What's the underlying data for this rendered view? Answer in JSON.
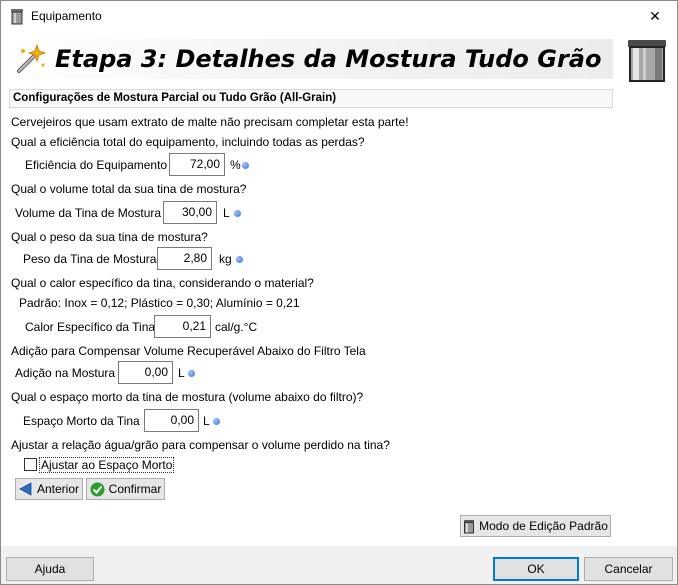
{
  "window": {
    "title": "Equipamento",
    "close_glyph": "✕",
    "icon": "pot-icon"
  },
  "header": {
    "title": "Etapa 3: Detalhes da Mostura Tudo Grão",
    "left_icon": "magic-wand-icon",
    "right_icon": "brew-pot-icon"
  },
  "section": {
    "title": "Configurações de Mostura Parcial ou Tudo Grão (All-Grain)"
  },
  "form": {
    "intro": "Cervejeiros que usam extrato de malte não precisam completar esta parte!",
    "q_efficiency": "Qual a eficiência total do equipamento, incluindo todas as perdas?",
    "efficiency_label": "Eficiência do Equipamento",
    "efficiency_value": "72,00",
    "efficiency_unit": "%",
    "q_volume": "Qual o volume total da sua tina de mostura?",
    "volume_label": "Volume da Tina de Mostura",
    "volume_value": "30,00",
    "volume_unit": "L",
    "q_weight": "Qual o peso da sua tina de mostura?",
    "weight_label": "Peso da Tina de Mostura",
    "weight_value": "2,80",
    "weight_unit": "kg",
    "q_specific_heat": "Qual o calor específico da tina, considerando o material?",
    "specific_heat_defaults": "Padrão:  Inox = 0,12;  Plástico = 0,30;  Alumínio = 0,21",
    "specific_heat_label": "Calor Específico da Tina",
    "specific_heat_value": "0,21",
    "specific_heat_unit": "cal/g.°C",
    "q_addition": "Adição para Compensar Volume Recuperável Abaixo do Filtro Tela",
    "addition_label": "Adição na Mostura",
    "addition_value": "0,00",
    "addition_unit": "L",
    "q_deadspace": "Qual o espaço morto da tina de mostura (volume abaixo do filtro)?",
    "deadspace_label": "Espaço Morto da Tina",
    "deadspace_value": "0,00",
    "deadspace_unit": "L",
    "q_adjust": "Ajustar a relação água/grão para compensar o volume perdido na tina?",
    "adjust_checkbox_label": "Ajustar ao Espaço Morto",
    "adjust_checked": false
  },
  "nav": {
    "back_label": "Anterior",
    "confirm_label": "Confirmar",
    "standard_mode_label": "Modo de Edição Padrão"
  },
  "footer": {
    "help_label": "Ajuda",
    "ok_label": "OK",
    "cancel_label": "Cancelar"
  },
  "colors": {
    "info_dot": "#2e6fd8",
    "default_button_border": "#0078d7",
    "back_arrow": "#2a6cc4",
    "confirm_check": "#2e9b2e"
  }
}
